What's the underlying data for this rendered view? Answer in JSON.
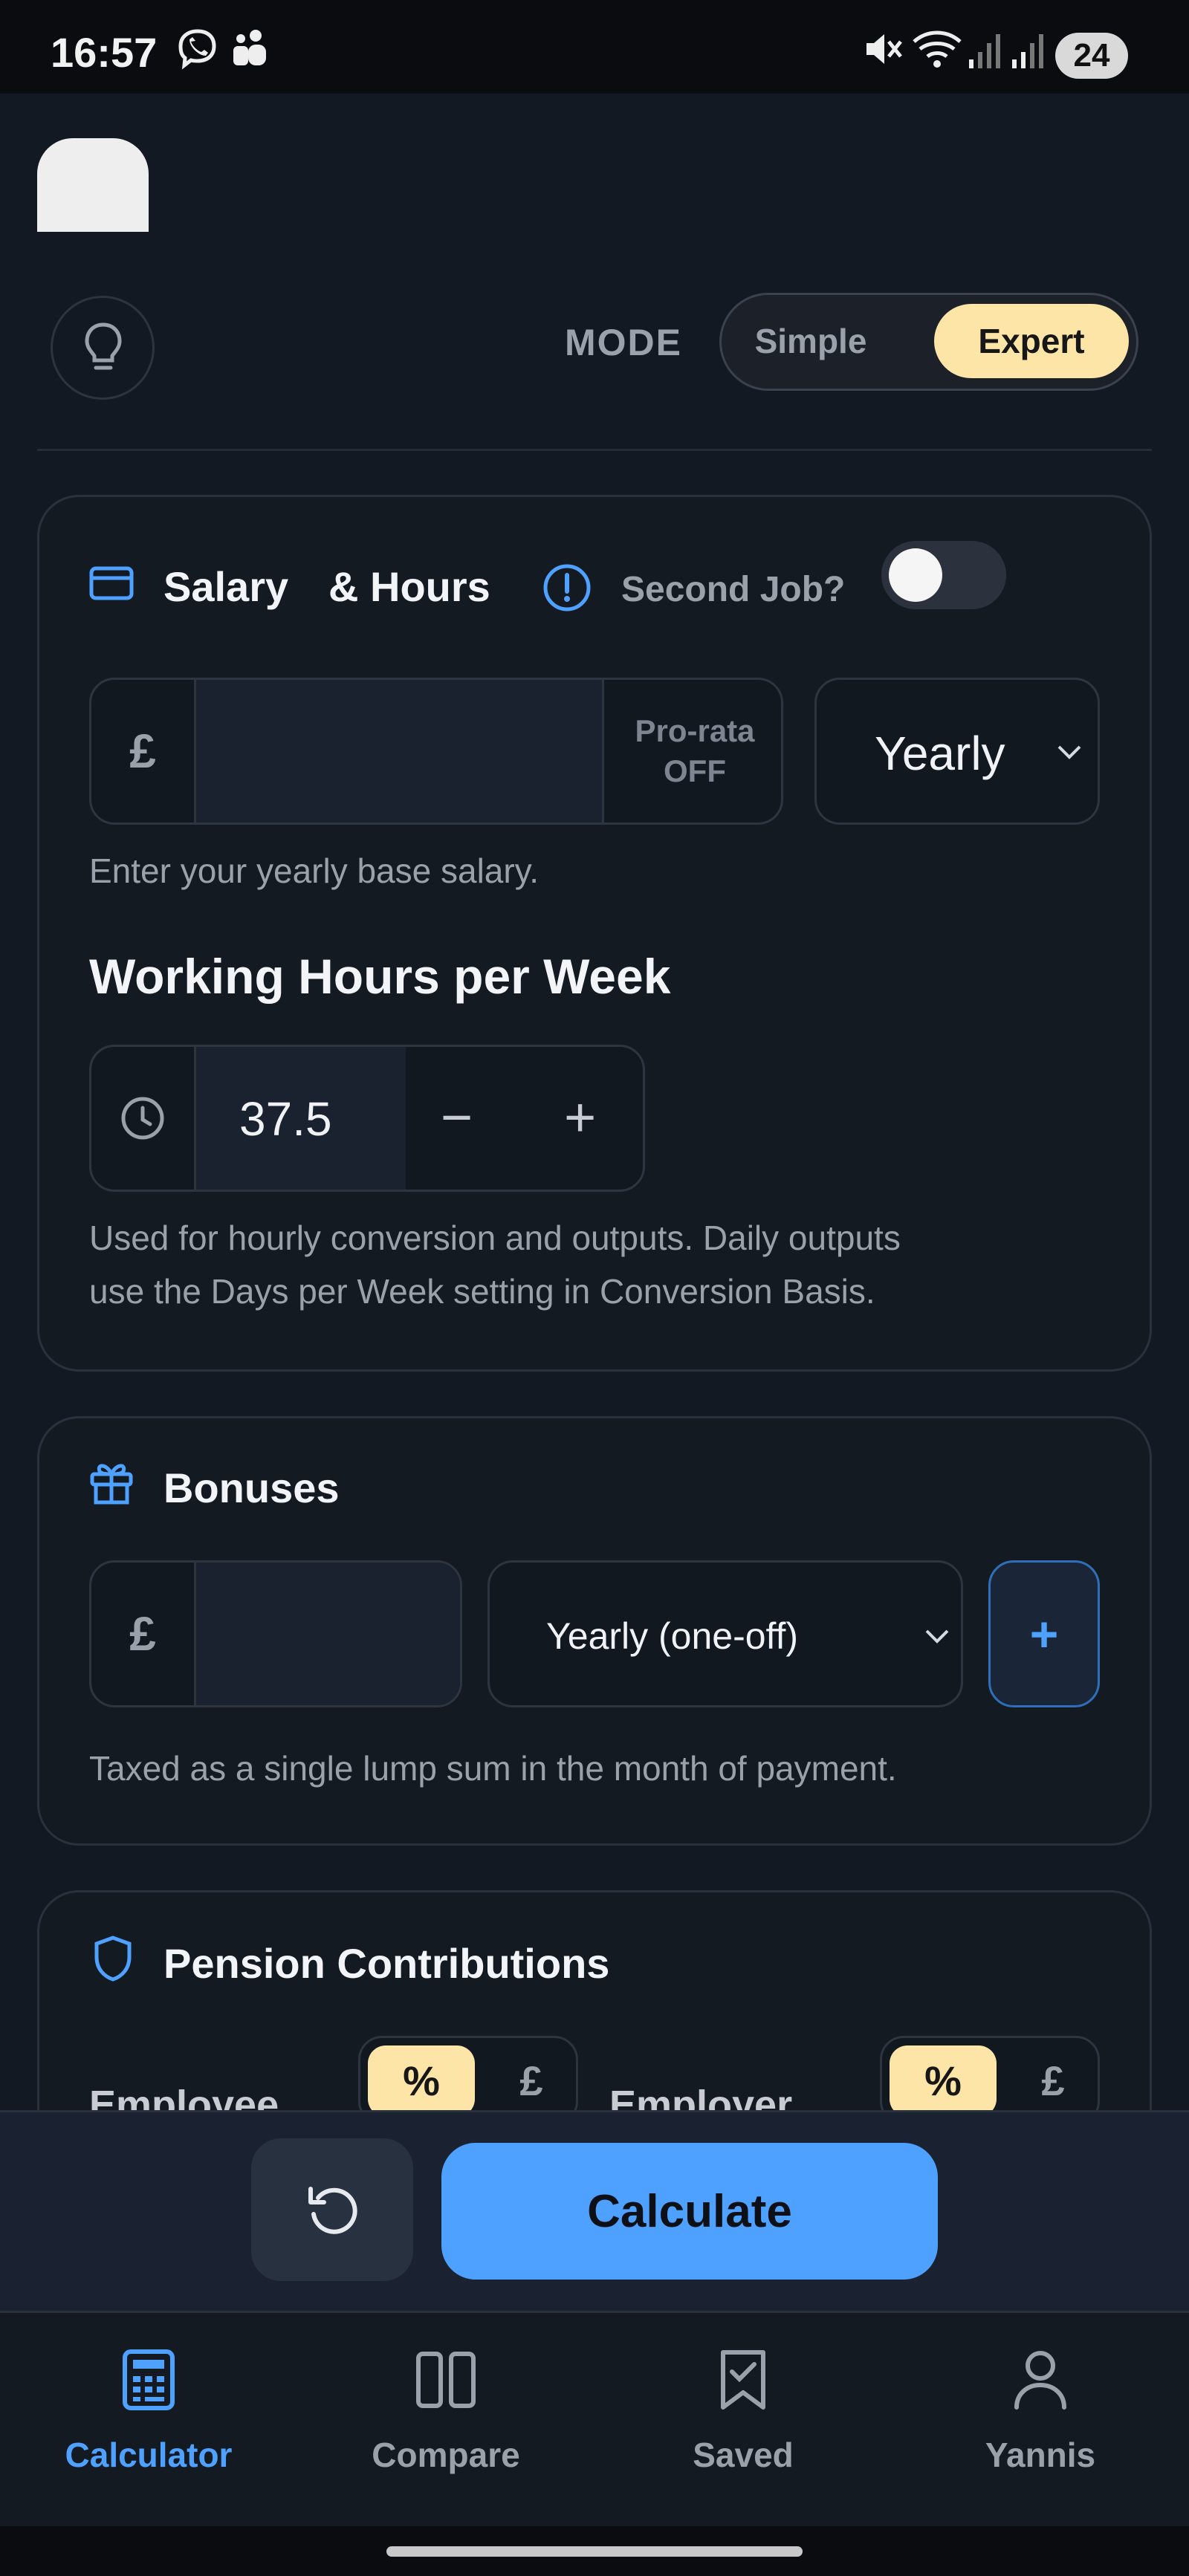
{
  "status_bar": {
    "time": "16:57",
    "battery": "24"
  },
  "mode": {
    "label": "MODE",
    "options": [
      "Simple",
      "Expert"
    ],
    "selected": "Expert"
  },
  "salary": {
    "title_a": "Salary",
    "title_b": "& Hours",
    "second_job_label": "Second Job?",
    "second_job_on": false,
    "currency": "£",
    "salary_value": "",
    "prorata_label": "Pro-rata",
    "prorata_state": "OFF",
    "period": "Yearly",
    "helper": "Enter your yearly base salary.",
    "hours_heading": "Working Hours per Week",
    "hours_value": "37.5",
    "minus": "−",
    "plus": "+",
    "hours_helper_1": "Used for hourly conversion and outputs. Daily outputs",
    "hours_helper_2": "use the Days per Week setting in Conversion Basis."
  },
  "bonuses": {
    "title": "Bonuses",
    "currency": "£",
    "value": "",
    "frequency": "Yearly (one-off)",
    "add": "+",
    "helper": "Taxed as a single lump sum in the month of payment."
  },
  "pension": {
    "title": "Pension Contributions",
    "employee_label": "Employee",
    "employer_label": "Employer",
    "pct": "%",
    "pound": "£"
  },
  "actions": {
    "calculate": "Calculate"
  },
  "nav": {
    "items": [
      {
        "label": "Calculator",
        "active": true
      },
      {
        "label": "Compare"
      },
      {
        "label": "Saved"
      },
      {
        "label": "Yannis"
      }
    ]
  },
  "colors": {
    "accent": "#4ea1ff",
    "highlight": "#fde5a8",
    "background": "#131922"
  }
}
